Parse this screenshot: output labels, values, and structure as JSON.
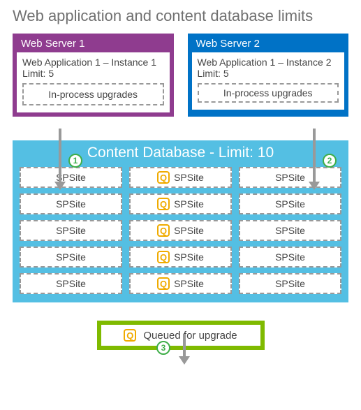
{
  "title": "Web application and content database limits",
  "servers": [
    {
      "header": "Web Server 1",
      "app_line": "Web Application 1 – Instance 1",
      "limit_line": "Limit: 5",
      "inproc_label": "In-process upgrades",
      "color": "purple"
    },
    {
      "header": "Web Server 2",
      "app_line": "Web Application 1 – Instance 2",
      "limit_line": "Limit: 5",
      "inproc_label": "In-process upgrades",
      "color": "blue"
    }
  ],
  "steps": {
    "one": "1",
    "two": "2",
    "three": "3"
  },
  "content_db": {
    "title": "Content Database - Limit: 10",
    "site_label": "SPSite",
    "columns": [
      {
        "kind": "plain",
        "count": 5
      },
      {
        "kind": "queued",
        "count": 5
      },
      {
        "kind": "plain",
        "count": 5
      }
    ]
  },
  "queued_legend": {
    "icon_letter": "Q",
    "label": "Queued for upgrade"
  },
  "colors": {
    "purple": "#8f3c8f",
    "blue": "#0072c6",
    "light_blue": "#54bfe3",
    "green": "#7fba00",
    "step_green": "#3fae49",
    "amber": "#f0ab00",
    "arrow": "#999999"
  }
}
